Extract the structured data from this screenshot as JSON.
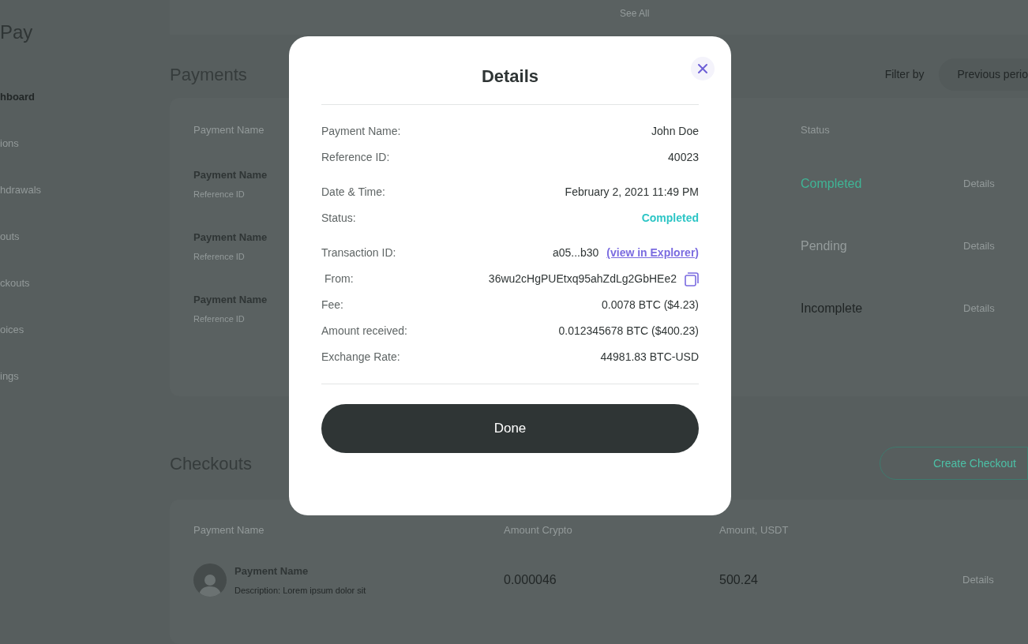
{
  "top_link": "See All",
  "logo": "Pay",
  "sidebar": {
    "items": [
      {
        "label": "hboard",
        "selected": true
      },
      {
        "label": "ions",
        "selected": false
      },
      {
        "label": "hdrawals",
        "selected": false
      },
      {
        "label": "outs",
        "selected": false
      },
      {
        "label": "ckouts",
        "selected": false
      },
      {
        "label": "oices",
        "selected": false
      },
      {
        "label": "ings",
        "selected": false
      }
    ]
  },
  "payments": {
    "title": "Payments",
    "filter_label": "Filter by",
    "filter_value": "Previous perio",
    "columns": [
      "Payment Name",
      "Status"
    ],
    "rows": [
      {
        "name": "Payment Name",
        "reference": "Reference ID",
        "status": "Completed",
        "color": "#3fb596",
        "action": "Details"
      },
      {
        "name": "Payment Name",
        "reference": "Reference ID",
        "status": "Pending",
        "color": "#959c9c",
        "action": "Details"
      },
      {
        "name": "Payment Name",
        "reference": "Reference ID",
        "status": "Incomplete",
        "color": "#1f2424",
        "action": "Details"
      }
    ]
  },
  "checkouts": {
    "title": "Checkouts",
    "create_button": "Create Checkout",
    "columns": [
      "Payment Name",
      "Amount Crypto",
      "Amount, USDT"
    ],
    "rows": [
      {
        "name": "Payment Name",
        "description": "Description: Lorem ipsum dolor sit",
        "amount_crypto": "0.000046",
        "amount_usdt": "500.24",
        "action": "Details"
      }
    ]
  },
  "dialog": {
    "title": "Details",
    "groups": [
      [
        {
          "kind": "text",
          "label": "Payment Name:",
          "value": "John Doe"
        },
        {
          "kind": "text",
          "label": "Reference ID:",
          "value": "40023"
        }
      ],
      [
        {
          "kind": "text",
          "label": "Date & Time:",
          "value": "February 2, 2021 11:49 PM"
        },
        {
          "kind": "status",
          "label": "Status:",
          "value": "Completed"
        }
      ],
      [
        {
          "kind": "link",
          "label": "Transaction ID:",
          "value": "a05...b30",
          "link": "(view in Explorer)"
        },
        {
          "kind": "copy",
          "label": "From:",
          "value": "36wu2cHgPUEtxq95ahZdLg2GbHEe2"
        },
        {
          "kind": "text",
          "label": "Fee:",
          "value": "0.0078 BTC ($4.23)"
        },
        {
          "kind": "text",
          "label": "Amount received:",
          "value": "0.012345678 BTC ($400.23)"
        },
        {
          "kind": "text",
          "label": "Exchange Rate:",
          "value": "44981.83 BTC-USD"
        }
      ]
    ],
    "button": "Done"
  }
}
